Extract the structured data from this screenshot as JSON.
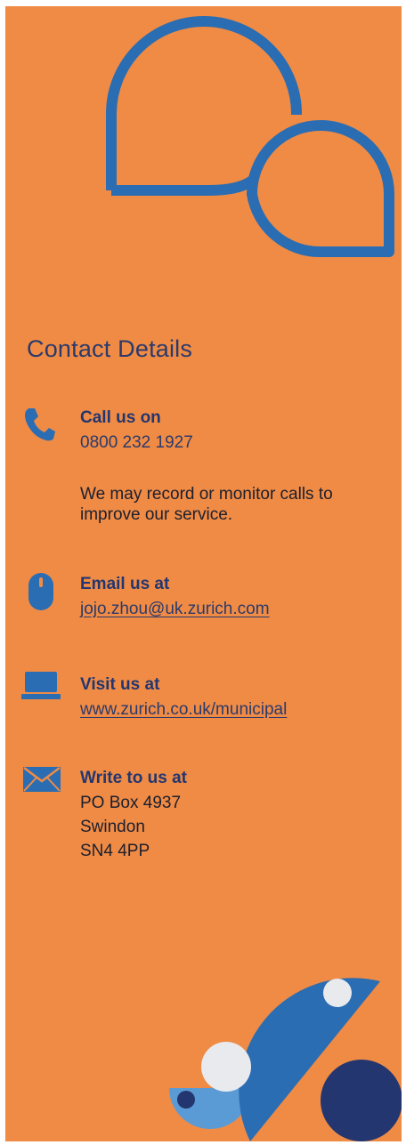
{
  "title": "Contact Details",
  "call": {
    "label": "Call us on",
    "number": "0800 232 1927",
    "note": "We may record or monitor calls to improve our service."
  },
  "email": {
    "label": "Email us at",
    "address": "jojo.zhou@uk.zurich.com"
  },
  "visit": {
    "label": "Visit us at",
    "url": "www.zurich.co.uk/municipal"
  },
  "write": {
    "label": "Write to us at",
    "address_lines": [
      "PO Box 4937",
      "Swindon",
      "SN4 4PP"
    ]
  },
  "icons": {
    "header": "speech-bubbles-icon",
    "call": "phone-icon",
    "email": "mouse-icon",
    "visit": "laptop-icon",
    "write": "envelope-icon"
  },
  "colors": {
    "background": "#ef8b45",
    "accent_blue": "#2a6db3",
    "navy": "#23366f",
    "light_blue": "#5b9bd5",
    "white_dot": "#e9eaee"
  }
}
